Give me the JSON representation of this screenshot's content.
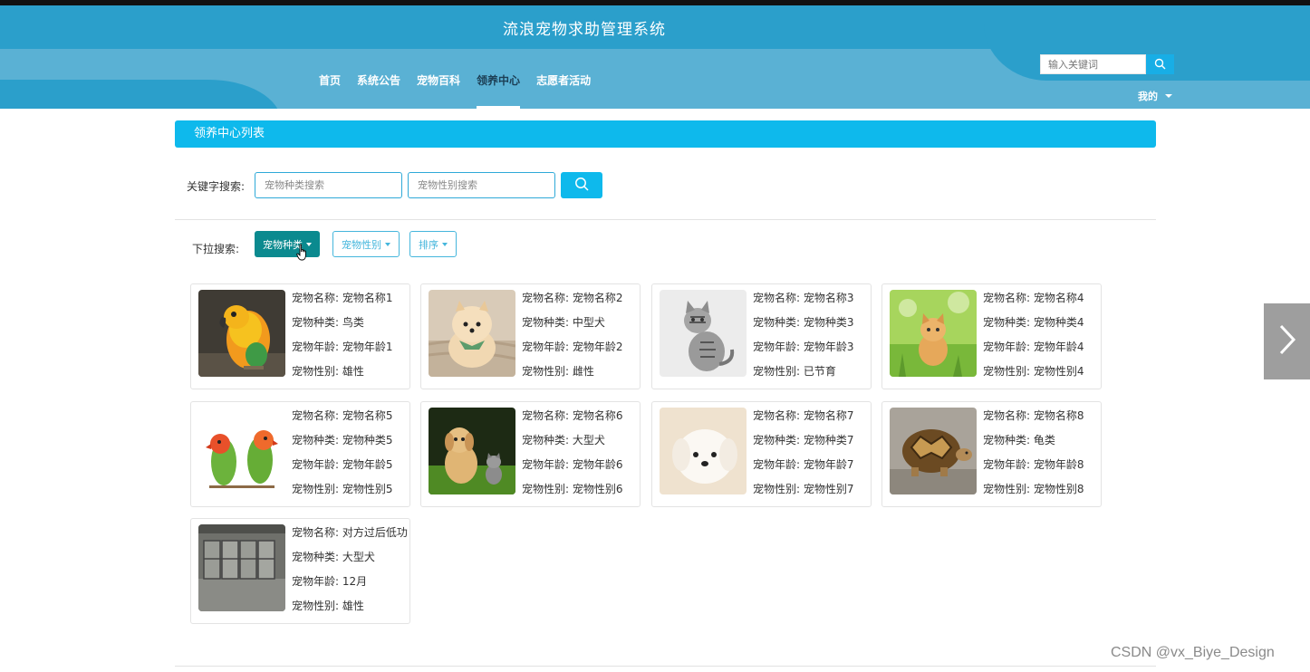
{
  "header": {
    "site_title": "流浪宠物求助管理系统",
    "nav": [
      {
        "label": "首页",
        "active": false
      },
      {
        "label": "系统公告",
        "active": false
      },
      {
        "label": "宠物百科",
        "active": false
      },
      {
        "label": "领养中心",
        "active": true
      },
      {
        "label": "志愿者活动",
        "active": false
      }
    ],
    "search_placeholder": "输入关键词",
    "user_menu": "我的",
    "colors": {
      "band": "#2b9fcb",
      "light": "#5ab1d4",
      "accent": "#18aee6"
    }
  },
  "section_title": "领养中心列表",
  "keyword_search": {
    "label": "关键字搜索:",
    "type_placeholder": "宠物种类搜索",
    "gender_placeholder": "宠物性别搜索",
    "button_icon": "search-icon"
  },
  "dropdown_search": {
    "label": "下拉搜索:",
    "filters": [
      "宠物种类",
      "宠物性别",
      "排序"
    ]
  },
  "field_labels": {
    "name": "宠物名称:",
    "type": "宠物种类:",
    "age": "宠物年龄:",
    "gender": "宠物性别:"
  },
  "pets": [
    {
      "name": "宠物名称1",
      "type": "鸟类",
      "age": "宠物年龄1",
      "gender": "雄性",
      "image": "parrot"
    },
    {
      "name": "宠物名称2",
      "type": "中型犬",
      "age": "宠物年龄2",
      "gender": "雌性",
      "image": "pomeranian"
    },
    {
      "name": "宠物名称3",
      "type": "宠物种类3",
      "age": "宠物年龄3",
      "gender": "已节育",
      "image": "tabby-cat"
    },
    {
      "name": "宠物名称4",
      "type": "宠物种类4",
      "age": "宠物年龄4",
      "gender": "宠物性别4",
      "image": "kitten-grass"
    },
    {
      "name": "宠物名称5",
      "type": "宠物种类5",
      "age": "宠物年龄5",
      "gender": "宠物性别5",
      "image": "lovebirds"
    },
    {
      "name": "宠物名称6",
      "type": "大型犬",
      "age": "宠物年龄6",
      "gender": "宠物性别6",
      "image": "puppy-kitten"
    },
    {
      "name": "宠物名称7",
      "type": "宠物种类7",
      "age": "宠物年龄7",
      "gender": "宠物性别7",
      "image": "white-puppy"
    },
    {
      "name": "宠物名称8",
      "type": "龟类",
      "age": "宠物年龄8",
      "gender": "宠物性别8",
      "image": "tortoise"
    },
    {
      "name": "对方过后低功",
      "type": "大型犬",
      "age": "12月",
      "gender": "雄性",
      "image": "kennel"
    }
  ],
  "next_button_icon": "chevron-right-icon",
  "watermark": "CSDN @vx_Biye_Design"
}
